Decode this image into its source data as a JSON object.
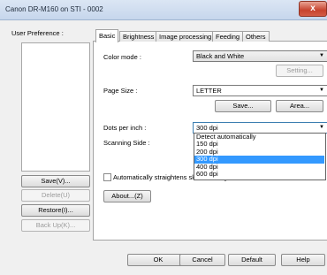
{
  "window": {
    "title": "Canon DR-M160 on STI - 0002",
    "close_glyph": "x"
  },
  "left": {
    "pref_label": "User Preference :",
    "save": "Save(V)...",
    "delete": "Delete(U)",
    "restore": "Restore(I)...",
    "backup": "Back Up(K)..."
  },
  "tabs": [
    "Basic",
    "Brightness",
    "Image processing",
    "Feeding",
    "Others"
  ],
  "basic": {
    "color_mode_label": "Color mode :",
    "color_mode_value": "Black and White",
    "setting_button": "Setting...",
    "page_size_label": "Page Size :",
    "page_size_value": "LETTER",
    "save_button": "Save...",
    "area_button": "Area...",
    "dpi_label": "Dots per inch :",
    "dpi_value": "300 dpi",
    "dpi_options": [
      "Detect automatically",
      "150 dpi",
      "200 dpi",
      "300 dpi",
      "400 dpi",
      "600 dpi"
    ],
    "dpi_selected_index": 3,
    "scanning_side_label": "Scanning Side :",
    "auto_straighten_label": "Automatically straightens skewed images",
    "about_button": "About...(Z)"
  },
  "bottom": {
    "ok": "OK",
    "cancel": "Cancel",
    "default": "Default",
    "help": "Help"
  }
}
